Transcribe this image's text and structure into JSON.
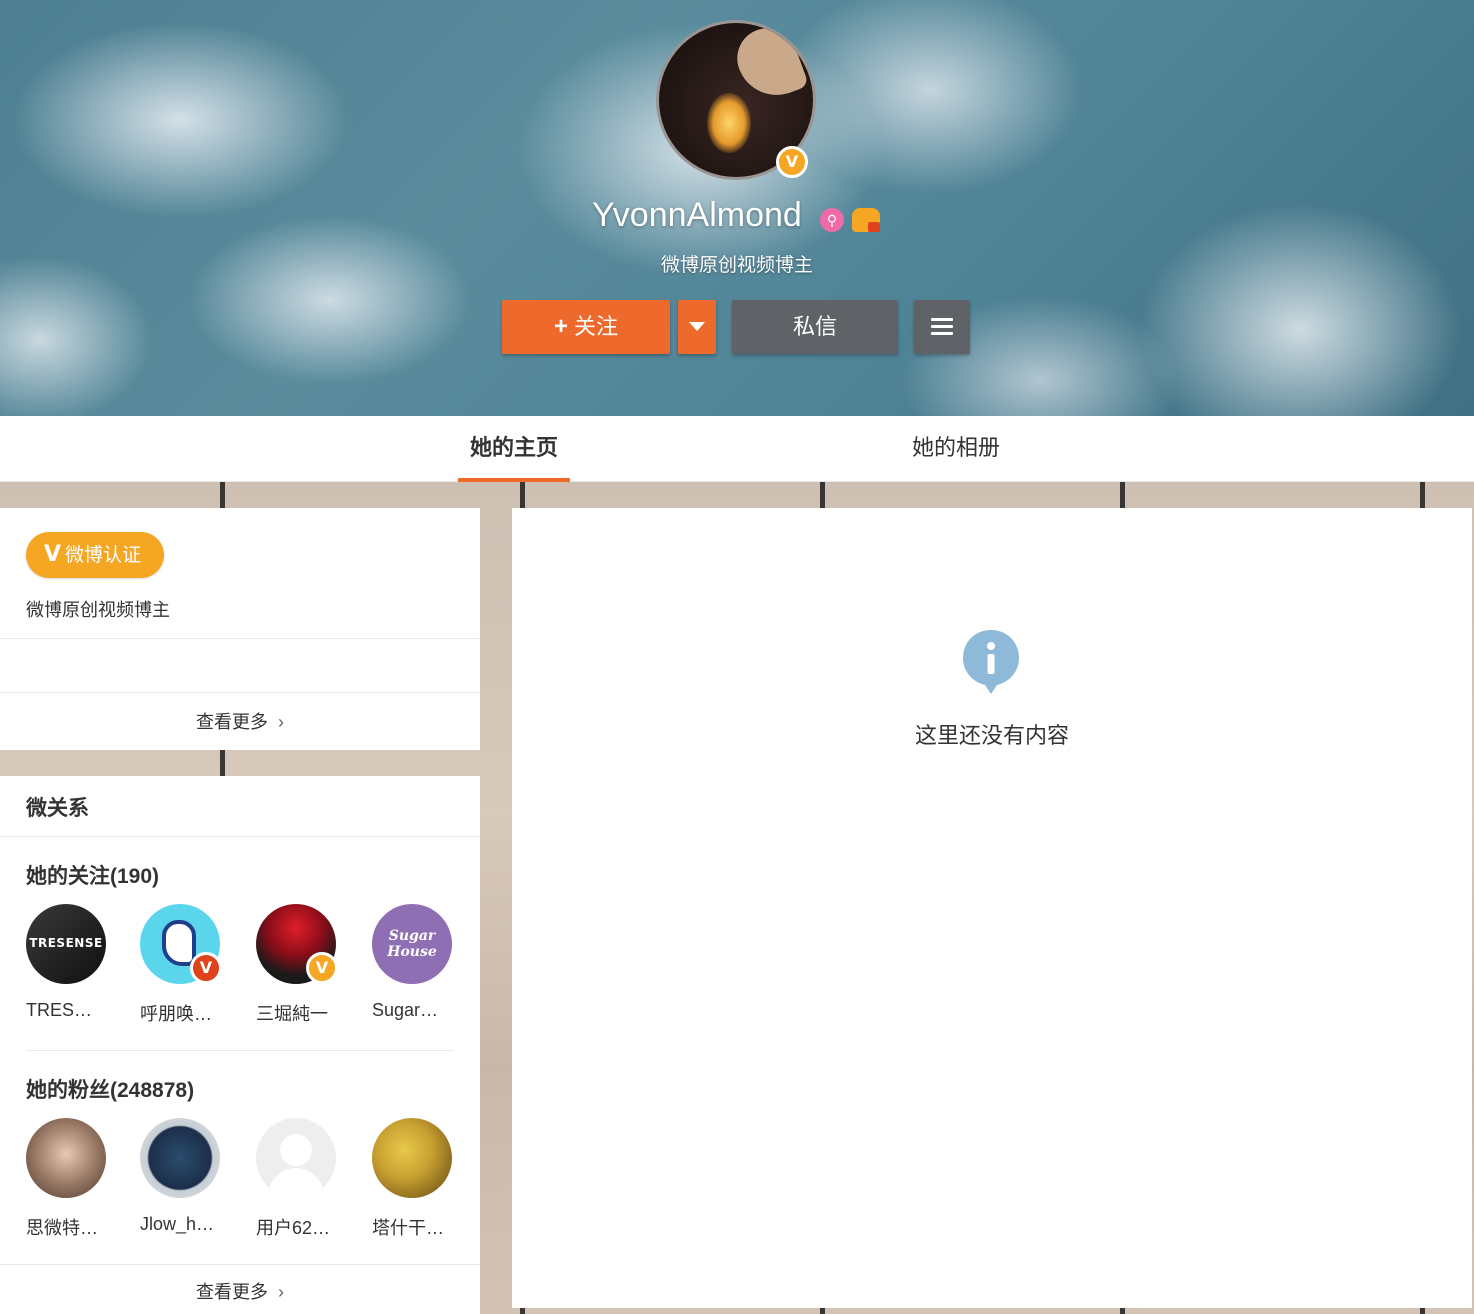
{
  "profile": {
    "username": "YvonnAlmond",
    "bio": "微博原创视频博主",
    "verified_mark": "V"
  },
  "actions": {
    "follow_plus": "+",
    "follow_label": "关注",
    "message_label": "私信"
  },
  "tabs": [
    {
      "label": "她的主页",
      "active": true
    },
    {
      "label": "她的相册",
      "active": false
    }
  ],
  "certification": {
    "pill_v": "V",
    "pill_label": "微博认证",
    "description": "微博原创视频博主",
    "see_more": "查看更多",
    "chevron": "›"
  },
  "relations": {
    "title": "微关系",
    "following": {
      "title": "她的关注(190)",
      "people": [
        {
          "name": "TRES…",
          "pic_text": "TRESENSE"
        },
        {
          "name": "呼朋唤…",
          "badge": "V"
        },
        {
          "name": "三堀純一",
          "badge": "V"
        },
        {
          "name": "Sugar…",
          "pic_text": "Sugar House"
        }
      ]
    },
    "fans": {
      "title": "她的粉丝(248878)",
      "people": [
        {
          "name": "思微特…"
        },
        {
          "name": "Jlow_h…"
        },
        {
          "name": "用户62…"
        },
        {
          "name": "塔什干…"
        }
      ]
    },
    "see_more": "查看更多",
    "chevron": "›"
  },
  "main": {
    "empty_text": "这里还没有内容",
    "icon": "info-icon"
  },
  "colors": {
    "accent": "#ed6a2c",
    "verified": "#f5a623",
    "dark_button": "#5f6367",
    "info": "#8fb9d8"
  }
}
